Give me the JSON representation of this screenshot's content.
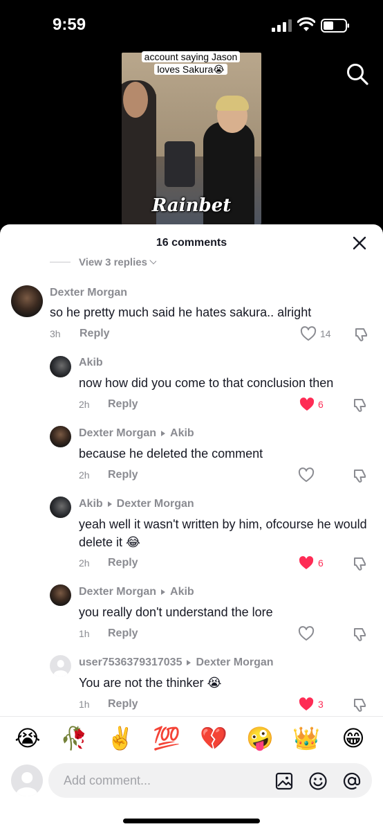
{
  "status_bar": {
    "time": "9:59"
  },
  "video": {
    "caption": "account saying Jason loves Sakura😭",
    "brand": "Rainbet"
  },
  "sheet": {
    "title": "16 comments",
    "view_replies": "View 3 replies"
  },
  "comments": [
    {
      "user": "Dexter Morgan",
      "reply_to": "",
      "text": "so he pretty much said he hates sakura.. alright",
      "time": "3h",
      "reply_label": "Reply",
      "likes": "14",
      "liked": false
    },
    {
      "user": "Akib",
      "reply_to": "",
      "text": "now how did you come to that conclusion then",
      "time": "2h",
      "reply_label": "Reply",
      "likes": "6",
      "liked": true
    },
    {
      "user": "Dexter Morgan",
      "reply_to": "Akib",
      "text": "because he deleted the comment",
      "time": "2h",
      "reply_label": "Reply",
      "likes": "",
      "liked": false
    },
    {
      "user": "Akib",
      "reply_to": "Dexter Morgan",
      "text": "yeah well it wasn't written by him, ofcourse he would delete it 😂",
      "time": "2h",
      "reply_label": "Reply",
      "likes": "6",
      "liked": true
    },
    {
      "user": "Dexter Morgan",
      "reply_to": "Akib",
      "text": "you really don't understand the lore",
      "time": "1h",
      "reply_label": "Reply",
      "likes": "",
      "liked": false
    },
    {
      "user": "user7536379317035",
      "reply_to": "Dexter Morgan",
      "text": "You are not the thinker 😭",
      "time": "1h",
      "reply_label": "Reply",
      "likes": "3",
      "liked": true
    }
  ],
  "emoji_bar": [
    "😭",
    "🥀",
    "✌️",
    "💯",
    "💔",
    "🤪",
    "👑",
    "😁"
  ],
  "input": {
    "placeholder": "Add comment..."
  },
  "colors": {
    "like_red": "#fe2c55",
    "muted": "#8a8b91",
    "text": "#161823"
  }
}
